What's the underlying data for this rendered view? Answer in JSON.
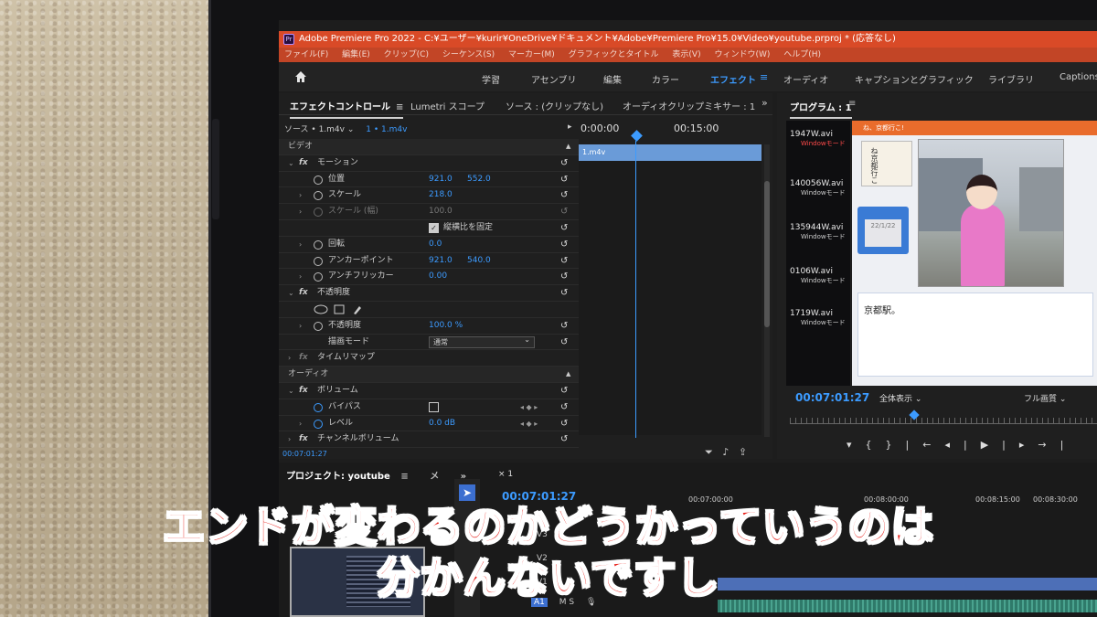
{
  "window": {
    "title": "Adobe Premiere Pro 2022 - C:¥ユーザー¥kurir¥OneDrive¥ドキュメント¥Adobe¥Premiere Pro¥15.0¥Video¥youtube.prproj * (応答なし)",
    "app_icon": "Pr"
  },
  "menu": [
    "ファイル(F)",
    "編集(E)",
    "クリップ(C)",
    "シーケンス(S)",
    "マーカー(M)",
    "グラフィックとタイトル",
    "表示(V)",
    "ウィンドウ(W)",
    "ヘルプ(H)"
  ],
  "workspaces": {
    "items": [
      "学習",
      "アセンブリ",
      "編集",
      "カラー",
      "エフェクト",
      "オーディオ",
      "キャプションとグラフィック",
      "ライブラリ",
      "Captions"
    ],
    "active": "エフェクト",
    "menu_glyph": "≡"
  },
  "effect_panel": {
    "tabs": [
      "エフェクトコントロール",
      "Lumetri スコープ",
      "ソース : (クリップなし)",
      "オーディオクリップミキサー : 1"
    ],
    "tab_menu": "≡",
    "chevron": "»",
    "source_label": "ソース • 1.m4v",
    "clip_label": "1 • 1.m4v",
    "ruler": [
      "0:00:00",
      "00:15:00"
    ],
    "clip_name": "1.m4v",
    "video_section": "ビデオ",
    "audio_section": "オーディオ",
    "rows": {
      "motion": "モーション",
      "position": {
        "label": "位置",
        "x": "921.0",
        "y": "552.0"
      },
      "scale": {
        "label": "スケール",
        "value": "218.0"
      },
      "scale_width": {
        "label": "スケール (幅)",
        "value": "100.0"
      },
      "uniform": {
        "label": "縦横比を固定",
        "checked": true
      },
      "rotation": {
        "label": "回転",
        "value": "0.0"
      },
      "anchor": {
        "label": "アンカーポイント",
        "x": "921.0",
        "y": "540.0"
      },
      "flicker": {
        "label": "アンチフリッカー",
        "value": "0.00"
      },
      "opacity_group": "不透明度",
      "opacity": {
        "label": "不透明度",
        "value": "100.0 %"
      },
      "blend": {
        "label": "描画モード",
        "value": "通常"
      },
      "timeremap": "タイムリマップ",
      "volume": "ボリューム",
      "bypass": {
        "label": "バイパス",
        "checked": false
      },
      "level": {
        "label": "レベル",
        "value": "0.0 dB"
      },
      "channel": "チャンネルボリューム"
    },
    "timecode": "00:07:01:27"
  },
  "program": {
    "title": "プログラム : 1",
    "menu": "≡",
    "files": [
      {
        "name": "1947W.avi",
        "mode": "Windowモード",
        "highlight": true
      },
      {
        "name": "140056W.avi",
        "mode": "Windowモード",
        "highlight": false
      },
      {
        "name": "135944W.avi",
        "mode": "Windowモード",
        "highlight": false
      },
      {
        "name": "0106W.avi",
        "mode": "Windowモード",
        "highlight": false
      },
      {
        "name": "1719W.avi",
        "mode": "Windowモード",
        "highlight": false
      }
    ],
    "video_header": "ね、京都行こ!",
    "book_text": "ね京都行こ",
    "floppy_date": "22/1/22",
    "dialog_text": "京都駅。",
    "timecode": "00:07:01:27",
    "fit": "全体表示",
    "quality": "フル画質",
    "controls": [
      "▾",
      "{",
      "}",
      "|←",
      "◂|",
      "▶",
      "|▸",
      "→|"
    ]
  },
  "project": {
    "tab": "プロジェクト: youtube",
    "tab_menu": "≡",
    "more": "メ",
    "chevron": "»"
  },
  "timeline": {
    "tab": "× 1",
    "timecode": "00:07:01:27",
    "ruler": [
      "00:07:00:00",
      "00:08:00:00",
      "00:08:15:00",
      "00:08:30:00"
    ],
    "tracks": [
      "V3",
      "V2",
      "V1",
      "A1"
    ],
    "audio_buttons": "M S"
  },
  "subtitles": {
    "line1": "エンドが変わるのかどうかっていうのは",
    "line2": "分かんないですし"
  },
  "colors": {
    "accent": "#3c9bff",
    "titlebar": "#d94a27",
    "subtitle_fill": "#e8211b",
    "subtitle_stroke": "#ffffff"
  }
}
